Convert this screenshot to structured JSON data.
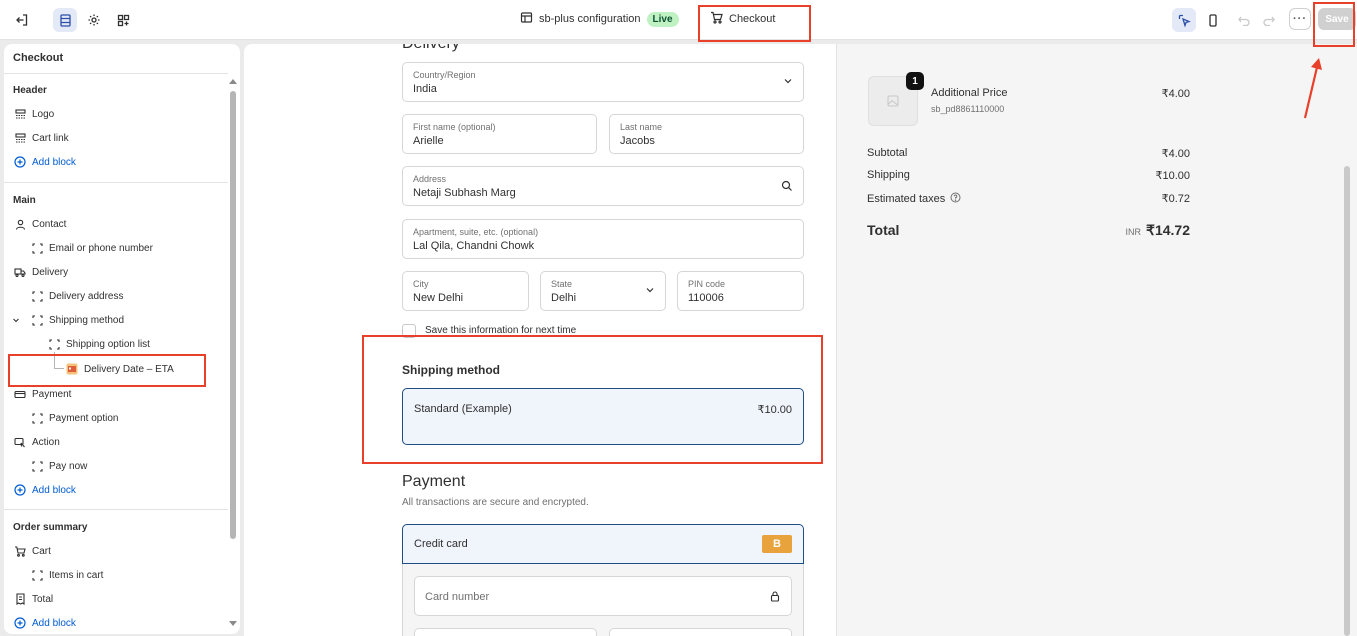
{
  "topbar": {
    "exit_icon": "exit-icon",
    "config_name": "sb-plus configuration",
    "live_badge": "Live",
    "page_name": "Checkout",
    "more_label": "···",
    "save_label": "Save"
  },
  "sidebar": {
    "title": "Checkout",
    "header_section": "Header",
    "header_items": [
      "Logo",
      "Cart link"
    ],
    "add_block": "Add block",
    "main_section": "Main",
    "contact": "Contact",
    "email_or_phone": "Email or phone number",
    "delivery": "Delivery",
    "delivery_address": "Delivery address",
    "shipping_method": "Shipping method",
    "shipping_option_list": "Shipping option list",
    "delivery_date_eta": "Delivery Date – ETA",
    "payment": "Payment",
    "payment_option": "Payment option",
    "action": "Action",
    "pay_now": "Pay now",
    "order_summary_section": "Order summary",
    "cart": "Cart",
    "items_in_cart": "Items in cart",
    "total": "Total"
  },
  "form": {
    "delivery_heading": "Delivery",
    "country_label": "Country/Region",
    "country_value": "India",
    "first_name_label": "First name (optional)",
    "first_name_value": "Arielle",
    "last_name_label": "Last name",
    "last_name_value": "Jacobs",
    "address_label": "Address",
    "address_value": "Netaji Subhash Marg",
    "apartment_label": "Apartment, suite, etc. (optional)",
    "apartment_value": "Lal Qila, Chandni Chowk",
    "city_label": "City",
    "city_value": "New Delhi",
    "state_label": "State",
    "state_value": "Delhi",
    "pin_label": "PIN code",
    "pin_value": "110006",
    "save_info": "Save this information for next time",
    "shipping_heading": "Shipping method",
    "shipping_option_name": "Standard (Example)",
    "shipping_option_price": "₹10.00",
    "payment_heading": "Payment",
    "payment_subtext": "All transactions are secure and encrypted.",
    "credit_card_label": "Credit card",
    "card_badge": "B",
    "card_number_placeholder": "Card number"
  },
  "summary": {
    "qty_badge": "1",
    "product_name": "Additional Price",
    "product_sku": "sb_pd8861110000",
    "product_price": "₹4.00",
    "subtotal_label": "Subtotal",
    "subtotal_value": "₹4.00",
    "shipping_label": "Shipping",
    "shipping_value": "₹10.00",
    "taxes_label": "Estimated taxes",
    "taxes_value": "₹0.72",
    "total_label": "Total",
    "currency": "INR",
    "total_value": "₹14.72"
  },
  "colors": {
    "accent_blue": "#005bd3",
    "highlight_red": "#e8402a",
    "live_green": "#bff1c2",
    "selected_border": "#1f4d86"
  }
}
